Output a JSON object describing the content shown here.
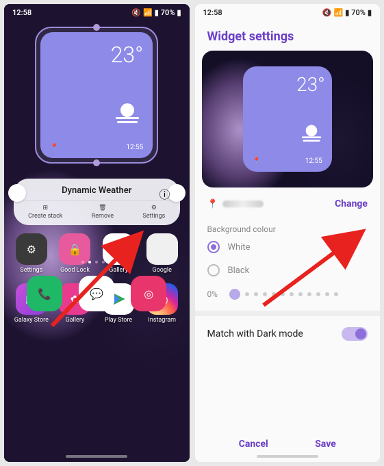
{
  "statusbar": {
    "time": "12:58",
    "battery": "70%"
  },
  "widget": {
    "temperature": "23°",
    "time": "12:55"
  },
  "popup": {
    "title": "Dynamic Weather",
    "actions": {
      "stack": "Create stack",
      "remove": "Remove",
      "settings": "Settings"
    }
  },
  "apps": {
    "settings": "Settings",
    "goodlock": "Good Lock",
    "gallery": "Gallery",
    "google": "Google",
    "galaxystore": "Galaxy Store",
    "galleryapp": "Gallery",
    "playstore": "Play Store",
    "instagram": "Instagram"
  },
  "right": {
    "title": "Widget settings",
    "change": "Change",
    "bg_label": "Background colour",
    "white": "White",
    "black": "Black",
    "opacity": "0%",
    "darkmode": "Match with Dark mode",
    "cancel": "Cancel",
    "save": "Save"
  }
}
